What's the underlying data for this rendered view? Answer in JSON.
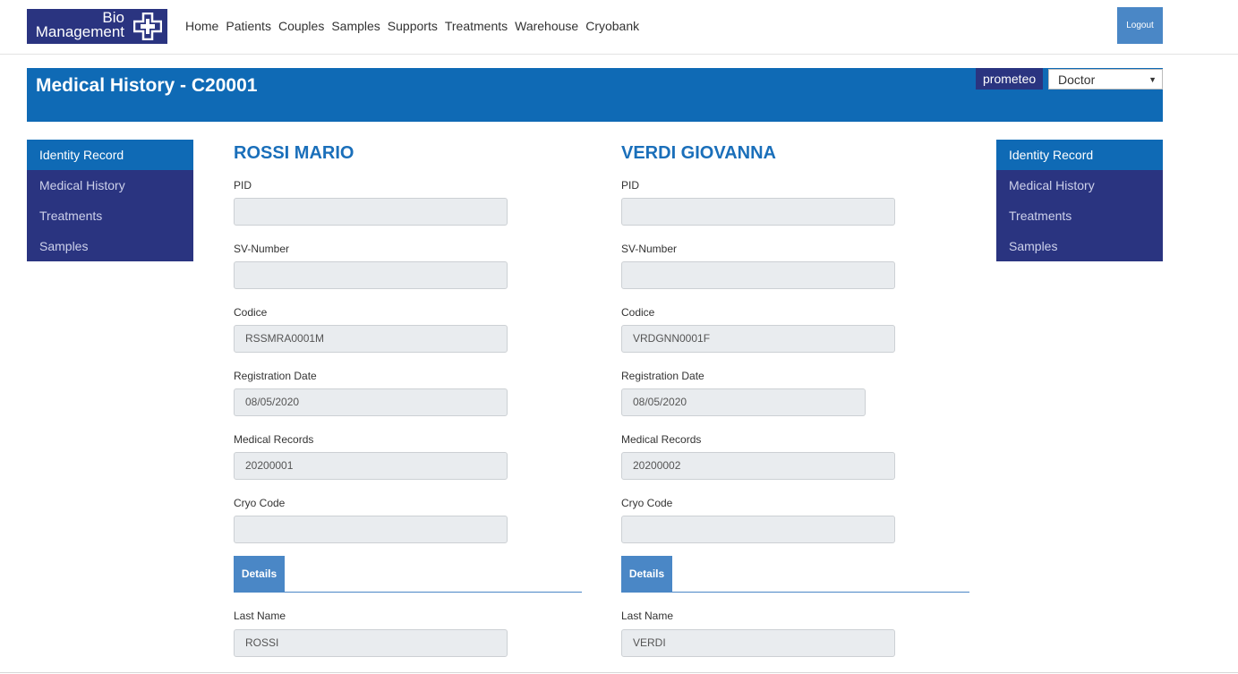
{
  "logo": {
    "line1": "Bio",
    "line2": "Management",
    "icon": "plus-cross-icon"
  },
  "nav": [
    "Home",
    "Patients",
    "Couples",
    "Samples",
    "Supports",
    "Treatments",
    "Warehouse",
    "Cryobank"
  ],
  "logout_label": "Logout",
  "header": {
    "title": "Medical History - C20001",
    "user": "prometeo",
    "role": "Doctor"
  },
  "side_menu_left": [
    "Identity Record",
    "Medical History",
    "Treatments",
    "Samples"
  ],
  "side_menu_right": [
    "Identity Record",
    "Medical History",
    "Treatments",
    "Samples"
  ],
  "partner1": {
    "name": "ROSSI MARIO",
    "fields": [
      {
        "label": "PID",
        "value": ""
      },
      {
        "label": "SV-Number",
        "value": ""
      },
      {
        "label": "Codice",
        "value": "RSSMRA0001M"
      },
      {
        "label": "Registration Date",
        "value": "08/05/2020"
      },
      {
        "label": "Medical Records",
        "value": "20200001"
      },
      {
        "label": "Cryo Code",
        "value": ""
      }
    ],
    "details_tab": "Details",
    "last_name_label": "Last Name",
    "last_name": "ROSSI"
  },
  "partner2": {
    "name": "VERDI GIOVANNA",
    "fields": [
      {
        "label": "PID",
        "value": ""
      },
      {
        "label": "SV-Number",
        "value": ""
      },
      {
        "label": "Codice",
        "value": "VRDGNN0001F"
      },
      {
        "label": "Registration Date",
        "value": "08/05/2020"
      },
      {
        "label": "Medical Records",
        "value": "20200002"
      },
      {
        "label": "Cryo Code",
        "value": ""
      }
    ],
    "details_tab": "Details",
    "last_name_label": "Last Name",
    "last_name": "VERDI"
  },
  "colors": {
    "brand_dark": "#2a3480",
    "brand_blue": "#0f6ab5",
    "tab_blue": "#4a87c6"
  }
}
